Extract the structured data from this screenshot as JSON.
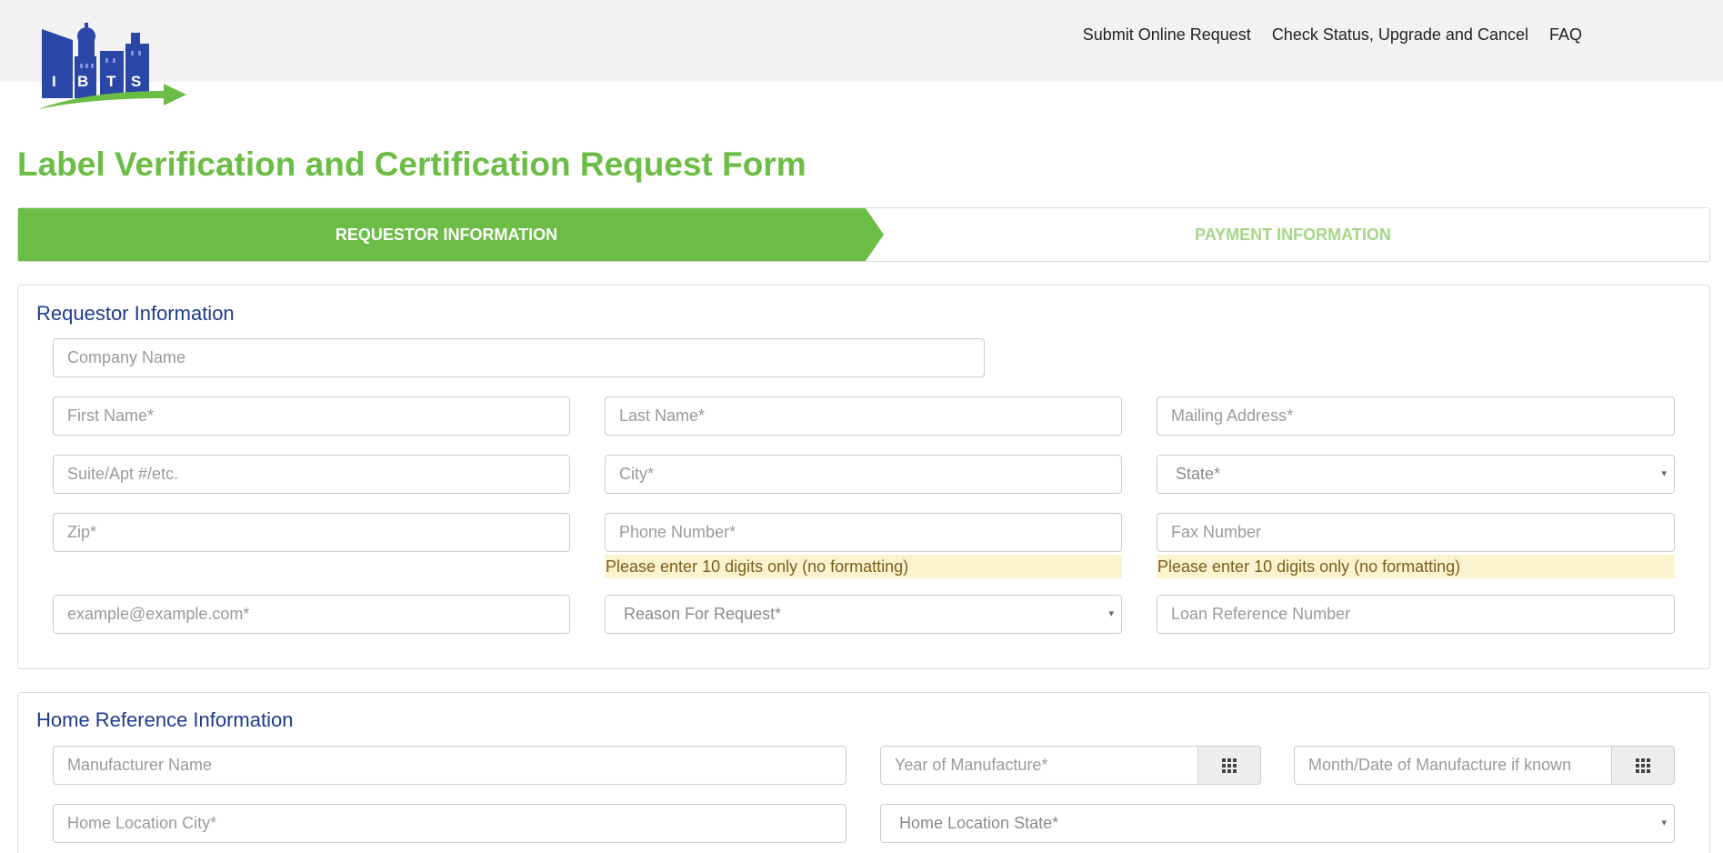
{
  "logo": {
    "letters": [
      "I",
      "B",
      "T",
      "S"
    ]
  },
  "nav": {
    "submit": "Submit Online Request",
    "status": "Check Status, Upgrade and Cancel",
    "faq": "FAQ"
  },
  "page_title": "Label Verification and Certification Request Form",
  "steps": {
    "requestor": "REQUESTOR INFORMATION",
    "payment": "PAYMENT INFORMATION"
  },
  "requestor": {
    "title": "Requestor Information",
    "company_placeholder": "Company Name",
    "first_name_placeholder": "First Name*",
    "last_name_placeholder": "Last Name*",
    "mailing_address_placeholder": "Mailing Address*",
    "suite_placeholder": "Suite/Apt #/etc.",
    "city_placeholder": "City*",
    "state_select": "State*",
    "zip_placeholder": "Zip*",
    "phone_placeholder": "Phone Number*",
    "fax_placeholder": "Fax Number",
    "phone_hint": "Please enter 10 digits only (no formatting)",
    "fax_hint": "Please enter 10 digits only (no formatting)",
    "email_placeholder": "example@example.com*",
    "reason_select": "Reason For Request*",
    "loan_placeholder": "Loan Reference Number"
  },
  "home": {
    "title": "Home Reference Information",
    "manufacturer_placeholder": "Manufacturer Name",
    "year_placeholder": "Year of Manufacture*",
    "month_placeholder": "Month/Date of Manufacture if known",
    "city_placeholder": "Home Location City*",
    "state_select": "Home Location State*"
  },
  "colors": {
    "brand_green": "#6cbd45",
    "heading_blue": "#1d3b8f",
    "hint_bg": "#fbf3cf"
  },
  "icons": {
    "select_caret": "▾",
    "calendar": "calendar-grid-icon"
  }
}
